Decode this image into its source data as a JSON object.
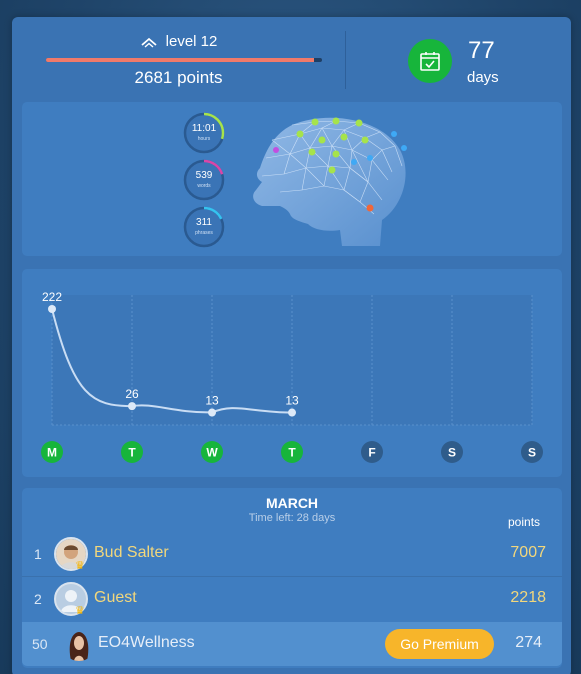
{
  "stats": {
    "level_label": "level 12",
    "level_progress": 0.97,
    "points_label": "2681 points",
    "days_value": "77",
    "days_label": "days"
  },
  "rings": [
    {
      "value": "11:01",
      "unit": "hours",
      "progress": 0.3,
      "color": "#a6e34b"
    },
    {
      "value": "539",
      "unit": "words",
      "progress": 0.2,
      "color": "#d946a8"
    },
    {
      "value": "311",
      "unit": "phrases",
      "progress": 0.18,
      "color": "#35c3f0"
    }
  ],
  "chart_data": {
    "type": "line",
    "categories": [
      "M",
      "T",
      "W",
      "T",
      "F",
      "S",
      "S"
    ],
    "values": [
      222,
      26,
      13,
      13,
      null,
      null,
      null
    ],
    "active_days": [
      true,
      true,
      true,
      true,
      false,
      false,
      false
    ],
    "ylim": [
      0,
      222
    ],
    "grid": "vertical",
    "active_color": "#17b53b",
    "inactive_color": "#2f5c8b"
  },
  "leaderboard": {
    "month": "MARCH",
    "time_left": "Time left: 28 days",
    "points_header": "points",
    "rows": [
      {
        "rank": "1",
        "name": "Bud Salter",
        "score": "7007"
      },
      {
        "rank": "2",
        "name": "Guest",
        "score": "2218"
      }
    ],
    "me": {
      "rank": "50",
      "name": "EO4Wellness",
      "score": "274",
      "button_label": "Go Premium"
    }
  }
}
